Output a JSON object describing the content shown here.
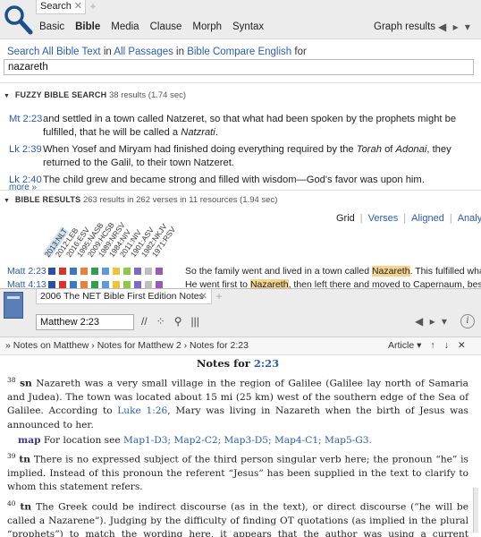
{
  "search": {
    "tab_label": "Search",
    "tab_close": "✕",
    "tab_new": "+",
    "subtabs": [
      "Basic",
      "Bible",
      "Media",
      "Clause",
      "Morph",
      "Syntax"
    ],
    "active_subtab": "Bible",
    "graph_results": "Graph results",
    "nav_arrows": "◀ ▸ ▾",
    "query_parts": {
      "w1": "Search",
      "w2": "All Bible Text",
      "w3": "in",
      "w4": "All Passages",
      "w5": "in",
      "w6": "Bible Compare English",
      "w7": "for"
    },
    "query_value": "nazareth"
  },
  "fuzzy": {
    "header": "FUZZY BIBLE SEARCH",
    "count": "38 results (1.74 sec)",
    "results": [
      {
        "ref": "Mt 2:23",
        "text": "and settled in a town called Natzeret, so that what had been spoken by the prophets might be fulfilled, that he will be called a Natzrati."
      },
      {
        "ref": "Lk 2:39",
        "text": "When Yosef and Miryam had finished doing everything required by the Torah of Adonai, they returned to the Galil, to their town Natzeret."
      },
      {
        "ref": "Lk 2:40",
        "text": "The child grew and became strong and filled with wisdom—God's favor was upon him."
      }
    ],
    "more": "more »"
  },
  "bible_results": {
    "header": "BIBLE RESULTS",
    "count": "263 results in 262 verses in 11 resources (1.94 sec)",
    "views": [
      "Grid",
      "Verses",
      "Aligned",
      "Analysis"
    ],
    "versions": [
      "2013:NLT",
      "2012:LEB",
      "2016:ESV",
      "1995:NASB",
      "2009:HCSB",
      "1989:NRSV",
      "1984:NIV",
      "2011:NIV",
      "1901:ASV",
      "1982:NKJV",
      "1971:RSV"
    ],
    "swatch_colors": [
      "#2c4f9e",
      "#d9342b",
      "#3a78c2",
      "#e8823a",
      "#2f9e52",
      "#5d9bd4",
      "#f0c23a",
      "#8fc74a",
      "#7a6ac4",
      "#bfbfbf",
      "#9b59b6"
    ],
    "rows": [
      {
        "ref": "Matt 2:23",
        "before": "So the family went and lived in a town called ",
        "hl": "Nazareth",
        "after": ". This fulfilled what the pro"
      },
      {
        "ref": "Matt 4:13",
        "before": "He went first to ",
        "hl": "Nazareth",
        "after": ", then left there and moved to Capernaum, beside the Se"
      }
    ]
  },
  "notes": {
    "tab_label": "2006 The NET Bible First Edition Notes",
    "tab_close": "✕",
    "tab_new": "+",
    "reference": "Matthew 2:23",
    "tool_icons": "// ⁘ ⚲ |||",
    "nav_arrows": "◀ ▸ ▾",
    "info": "i",
    "breadcrumb": "»  Notes on Matthew  › Notes for Matthew 2  › Notes for  2:23",
    "article": "Article ▾",
    "up": "↑",
    "down": "↓",
    "close": "✕",
    "title_prefix": "Notes for",
    "title_ref": "2:23",
    "n38_num": "38",
    "n38_label": "sn",
    "n38_text_a": "Nazareth was a very small village in the region of Galilee (Galilee lay north of Samaria and Judea). The town was located about 15 mi (25 km) west of the southern edge of the Sea of Galilee. According to ",
    "n38_link": "Luke 1:26",
    "n38_text_b": ", Mary was living in Nazareth when the birth of Jesus was announced to her.",
    "map_label": "map",
    "map_text": "For location see",
    "maps": "Map1-D3; Map2-C2; Map3-D5; Map4-C1; Map5-G3.",
    "n39_num": "39",
    "n39_label": "tn",
    "n39_text": "There is no expressed subject of the third person singular verb here; the pronoun “he” is implied. Instead of this pronoun the referent “Jesus” has been supplied in the text to clarify to whom this statement refers.",
    "n40_num": "40",
    "n40_label": "tn",
    "n40_text": "The Greek could be indirect discourse (as in the text), or direct discourse (“he will be called a Nazarene”). Judging by the difficulty of finding OT quotations (as implied in the plural “prophets”) to match the wording here, it appears that the author was using a current expression of scorn that conceptually (but not verbally) found its roots in the OT."
  }
}
